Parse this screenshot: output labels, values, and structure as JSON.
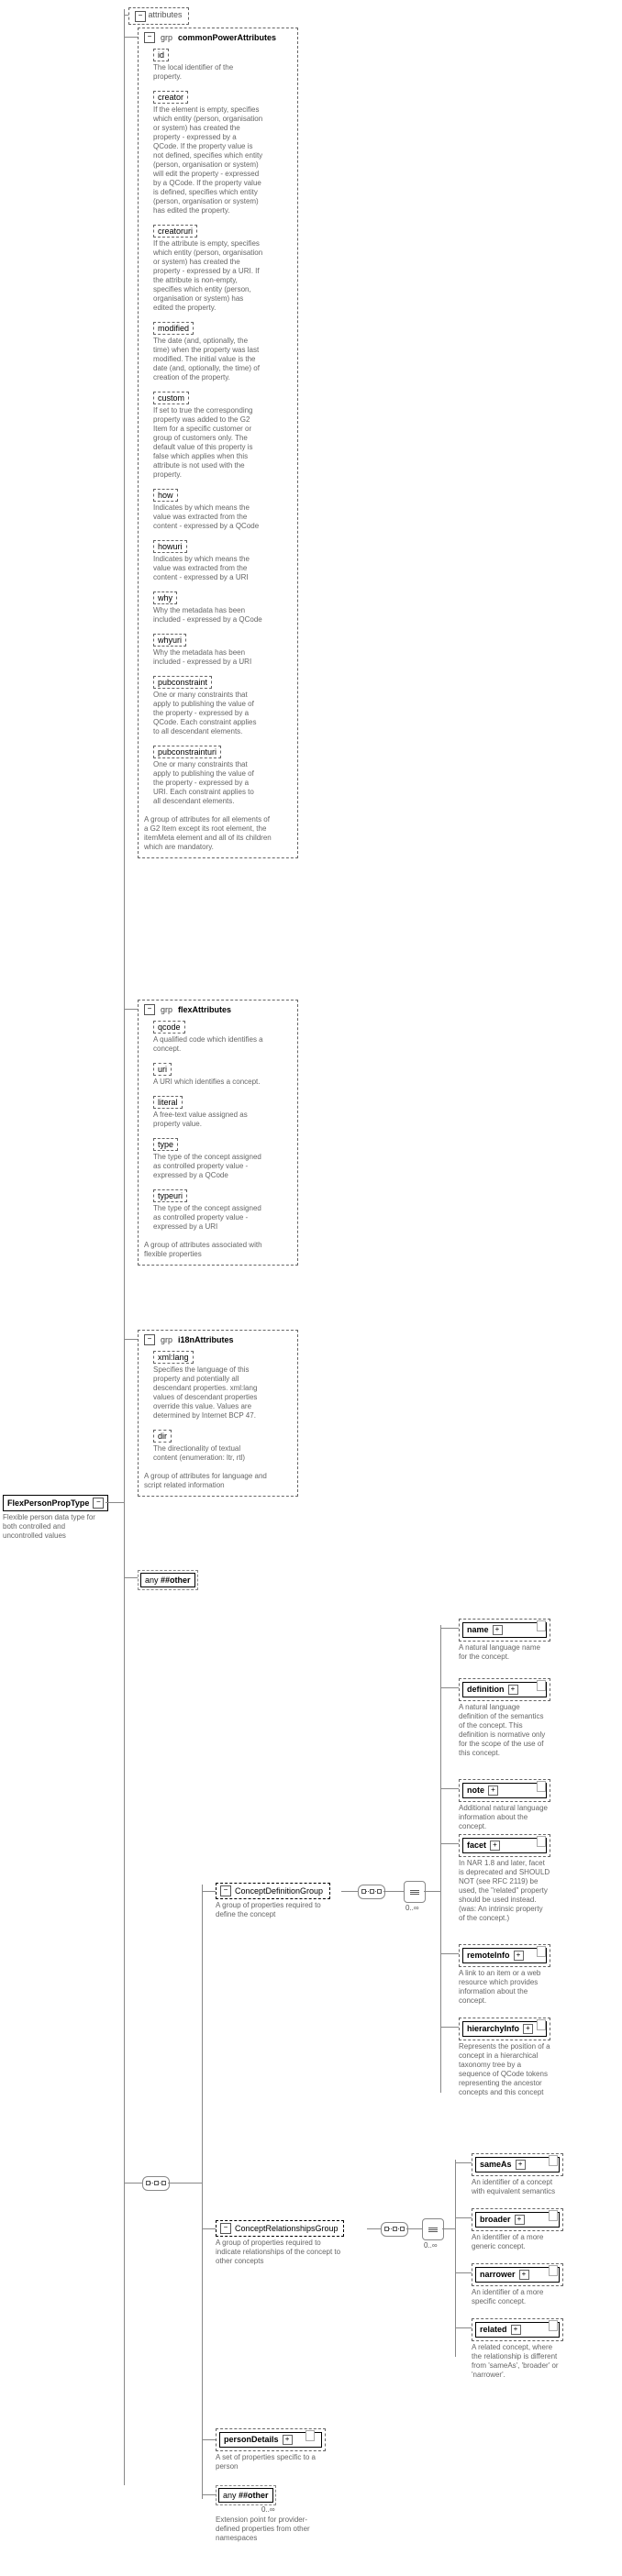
{
  "root": {
    "label": "FlexPersonPropType",
    "desc": "Flexible person data type for both controlled and uncontrolled values"
  },
  "attributes_label": "attributes",
  "grp_label": "grp",
  "grp_common": {
    "title": "commonPowerAttributes",
    "footer": "A group of attributes for all elements of a G2 Item except its root element, the itemMeta element and all of its children which are mandatory.",
    "attrs": [
      {
        "name": "id",
        "desc": "The local identifier of the property."
      },
      {
        "name": "creator",
        "desc": "If the element is empty, specifies which entity (person, organisation or system) has created the property - expressed by a QCode. If the property value is not defined, specifies which entity (person, organisation or system) will edit the property - expressed by a QCode. If the property value is defined, specifies which entity (person, organisation or system) has edited the property."
      },
      {
        "name": "creatoruri",
        "desc": "If the attribute is empty, specifies which entity (person, organisation or system) has created the property - expressed by a URI. If the attribute is non-empty, specifies which entity (person, organisation or system) has edited the property."
      },
      {
        "name": "modified",
        "desc": "The date (and, optionally, the time) when the property was last modified. The initial value is the date (and, optionally, the time) of creation of the property."
      },
      {
        "name": "custom",
        "desc": "If set to true the corresponding property was added to the G2 Item for a specific customer or group of customers only. The default value of this property is false which applies when this attribute is not used with the property."
      },
      {
        "name": "how",
        "desc": "Indicates by which means the value was extracted from the content - expressed by a QCode"
      },
      {
        "name": "howuri",
        "desc": "Indicates by which means the value was extracted from the content - expressed by a URI"
      },
      {
        "name": "why",
        "desc": "Why the metadata has been included - expressed by a QCode"
      },
      {
        "name": "whyuri",
        "desc": "Why the metadata has been included - expressed by a URI"
      },
      {
        "name": "pubconstraint",
        "desc": "One or many constraints that apply to publishing the value of the property - expressed by a QCode. Each constraint applies to all descendant elements."
      },
      {
        "name": "pubconstrainturi",
        "desc": "One or many constraints that apply to publishing the value of the property - expressed by a URI. Each constraint applies to all descendant elements."
      }
    ]
  },
  "grp_flex": {
    "title": "flexAttributes",
    "footer": "A group of attributes associated with flexible properties",
    "attrs": [
      {
        "name": "qcode",
        "desc": "A qualified code which identifies a concept."
      },
      {
        "name": "uri",
        "desc": "A URI which identifies a concept."
      },
      {
        "name": "literal",
        "desc": "A free-text value assigned as property value."
      },
      {
        "name": "type",
        "desc": "The type of the concept assigned as controlled property value - expressed by a QCode"
      },
      {
        "name": "typeuri",
        "desc": "The type of the concept assigned as controlled property value - expressed by a URI"
      }
    ]
  },
  "grp_i18n": {
    "title": "i18nAttributes",
    "footer": "A group of attributes for language and script related information",
    "attrs": [
      {
        "name": "xml:lang",
        "desc": "Specifies the language of this property and potentially all descendant properties. xml:lang values of descendant properties override this value. Values are determined by Internet BCP 47."
      },
      {
        "name": "dir",
        "desc": "The directionality of textual content (enumeration: ltr, rtl)"
      }
    ]
  },
  "any_attr": {
    "label": "any",
    "ns": "##other"
  },
  "groups": {
    "conceptDef": {
      "label": "ConceptDefinitionGroup",
      "desc": "A group of properties required to define the concept"
    },
    "conceptRel": {
      "label": "ConceptRelationshipsGroup",
      "desc": "A group of properties required to indicate relationships of the concept to other concepts"
    }
  },
  "def_children": [
    {
      "name": "name",
      "desc": "A natural language name for the concept."
    },
    {
      "name": "definition",
      "desc": "A natural language definition of the semantics of the concept. This definition is normative only for the scope of the use of this concept."
    },
    {
      "name": "note",
      "desc": "Additional natural language information about the concept."
    },
    {
      "name": "facet",
      "desc": "In NAR 1.8 and later, facet is deprecated and SHOULD NOT (see RFC 2119) be used, the \"related\" property should be used instead. (was: An intrinsic property of the concept.)"
    },
    {
      "name": "remoteInfo",
      "desc": "A link to an item or a web resource which provides information about the concept."
    },
    {
      "name": "hierarchyInfo",
      "desc": "Represents the position of a concept in a hierarchical taxonomy tree by a sequence of QCode tokens representing the ancestor concepts and this concept"
    }
  ],
  "rel_children": [
    {
      "name": "sameAs",
      "desc": "An identifier of a concept with equivalent semantics"
    },
    {
      "name": "broader",
      "desc": "An identifier of a more generic concept."
    },
    {
      "name": "narrower",
      "desc": "An identifier of a more specific concept."
    },
    {
      "name": "related",
      "desc": "A related concept, where the relationship is different from 'sameAs', 'broader' or 'narrower'."
    }
  ],
  "personDetails": {
    "label": "personDetails",
    "desc": "A set of properties specific to a person"
  },
  "any_elem": {
    "label": "any",
    "ns": "##other",
    "count": "0..∞",
    "desc": "Extension point for provider-defined properties from other namespaces"
  },
  "count_label": "0..∞"
}
